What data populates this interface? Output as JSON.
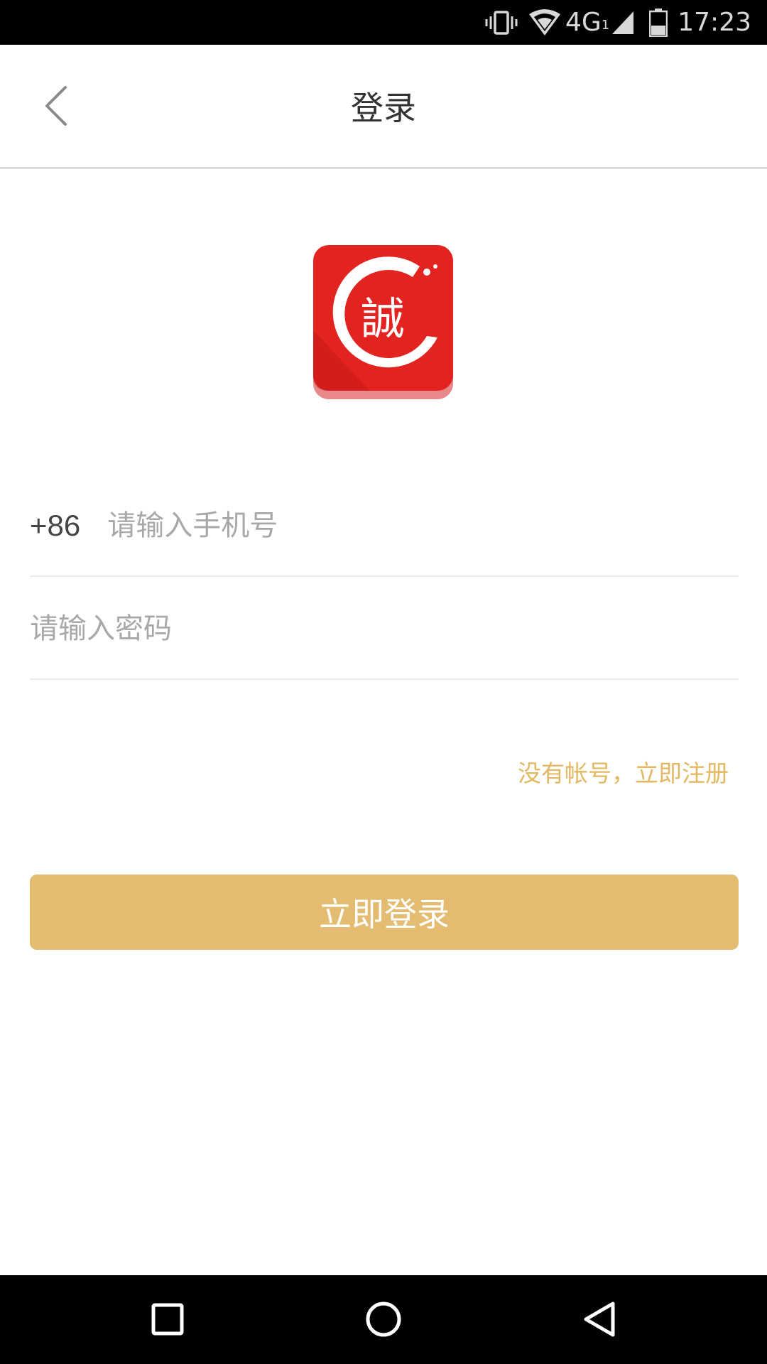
{
  "status_bar": {
    "network": "4G",
    "network_sub": "1",
    "time": "17:23",
    "icons": [
      "vibrate-icon",
      "wifi-icon",
      "cell-signal-icon",
      "battery-icon"
    ]
  },
  "app_bar": {
    "title": "登录",
    "back_icon": "chevron-left-icon"
  },
  "logo": {
    "character": "誠",
    "color": "#e2231f"
  },
  "form": {
    "country_code": "+86",
    "phone_placeholder": "请输入手机号",
    "phone_value": "",
    "password_placeholder": "请输入密码",
    "password_value": ""
  },
  "register_link": "没有帐号，立即注册",
  "login_button": "立即登录",
  "nav_bar": {
    "icons": [
      "recents-square-icon",
      "home-circle-icon",
      "back-triangle-icon"
    ]
  },
  "colors": {
    "accent": "#e3bc71",
    "link": "#e3b862",
    "status_bar": "#000000",
    "brand_red": "#e2231f"
  }
}
